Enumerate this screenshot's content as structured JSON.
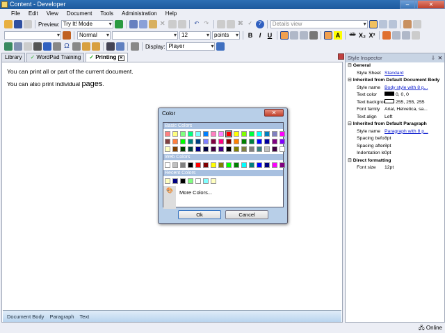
{
  "window": {
    "title": "Content - Developer",
    "min": "–",
    "max": "▢",
    "close": "✕"
  },
  "menu": [
    "File",
    "Edit",
    "View",
    "Document",
    "Tools",
    "Administration",
    "Help"
  ],
  "toolbar": {
    "preview_label": "Preview:",
    "preview_value": "Try It! Mode",
    "view_value": "Details view",
    "style_value": "Normal",
    "font_value": "",
    "size_value": "12",
    "unit_value": "points",
    "display_label": "Display:",
    "display_value": "Player",
    "bold": "B",
    "italic": "I",
    "underline": "U",
    "sub": "X₂",
    "sup": "X²",
    "highlight": "A"
  },
  "tabs": [
    {
      "label": "Library"
    },
    {
      "label": "WordPad Training"
    },
    {
      "label": "Printing",
      "close": "✕"
    }
  ],
  "document": {
    "line1": "You can print all or part of the current document.",
    "line2_prefix": "You can also print individual ",
    "line2_big": "pages",
    "line2_suffix": "."
  },
  "breadcrumbs": [
    "Document Body",
    "Paragraph",
    "Text"
  ],
  "inspector": {
    "title": "Style Inspector",
    "pin": "⇩",
    "close": "✕",
    "rows": [
      {
        "group": "General"
      },
      {
        "k": "Style Sheet",
        "v": "Standard",
        "link": true
      },
      {
        "group": "Inherited from Default Document Body"
      },
      {
        "k": "Style name",
        "v": "Body style with 8 p...",
        "link": true
      },
      {
        "k": "Text color",
        "v": "0, 0, 0",
        "swatch": "#000000"
      },
      {
        "k": "Text background c",
        "v": "255, 255, 255",
        "swatch": "#ffffff"
      },
      {
        "k": "Font family",
        "v": "Arial, Helvetica, sa..."
      },
      {
        "k": "Text align",
        "v": "Left"
      },
      {
        "group": "Inherited from Default Paragraph"
      },
      {
        "k": "Style name",
        "v": "Paragraph with 8 p...",
        "link": true
      },
      {
        "k": "Spacing before",
        "v": "8pt"
      },
      {
        "k": "Spacing after",
        "v": "8pt"
      },
      {
        "k": "Indentation left",
        "v": "0pt"
      },
      {
        "group": "Direct formatting"
      },
      {
        "k": "Font size",
        "v": "12pt"
      }
    ]
  },
  "status": {
    "online": "Online"
  },
  "dialog": {
    "title": "Color",
    "close": "✕",
    "basic_label": "Basic Colors",
    "web_label": "Web Colors",
    "recent_label": "Recent Colors",
    "more": "More Colors...",
    "ok": "Ok",
    "cancel": "Cancel",
    "selected": "#ff0000",
    "basic": [
      "#ff8080",
      "#ffff80",
      "#80ff80",
      "#00ff80",
      "#80ffff",
      "#0080ff",
      "#ff80c0",
      "#ff80ff",
      "#ff0000",
      "#ffff00",
      "#80ff00",
      "#00ff40",
      "#00ffff",
      "#0080c0",
      "#8080c0",
      "#ff00ff",
      "#804040",
      "#ff8040",
      "#00ff00",
      "#008080",
      "#004080",
      "#8080ff",
      "#800040",
      "#ff0080",
      "#800000",
      "#ff8000",
      "#008000",
      "#008040",
      "#0000ff",
      "#0000a0",
      "#800080",
      "#8000ff",
      "#ffffc0",
      "#804000",
      "#004000",
      "#004040",
      "#000080",
      "#000040",
      "#400040",
      "#400080",
      "#000000",
      "#808000",
      "#808040",
      "#808080",
      "#408080",
      "#c0c0c0",
      "#400040",
      "#ffffff"
    ],
    "web": [
      "#ffffff",
      "#c0c0c0",
      "#808080",
      "#000000",
      "#ff0000",
      "#800000",
      "#ffff00",
      "#808000",
      "#00ff00",
      "#008000",
      "#00ffff",
      "#008080",
      "#0000ff",
      "#000080",
      "#ff00ff",
      "#800080"
    ],
    "recent": [
      "#ffffc0",
      "#000080",
      "#000000",
      "#80ff80",
      "#ffffff",
      "#80ffff",
      "#ffffc0"
    ]
  }
}
